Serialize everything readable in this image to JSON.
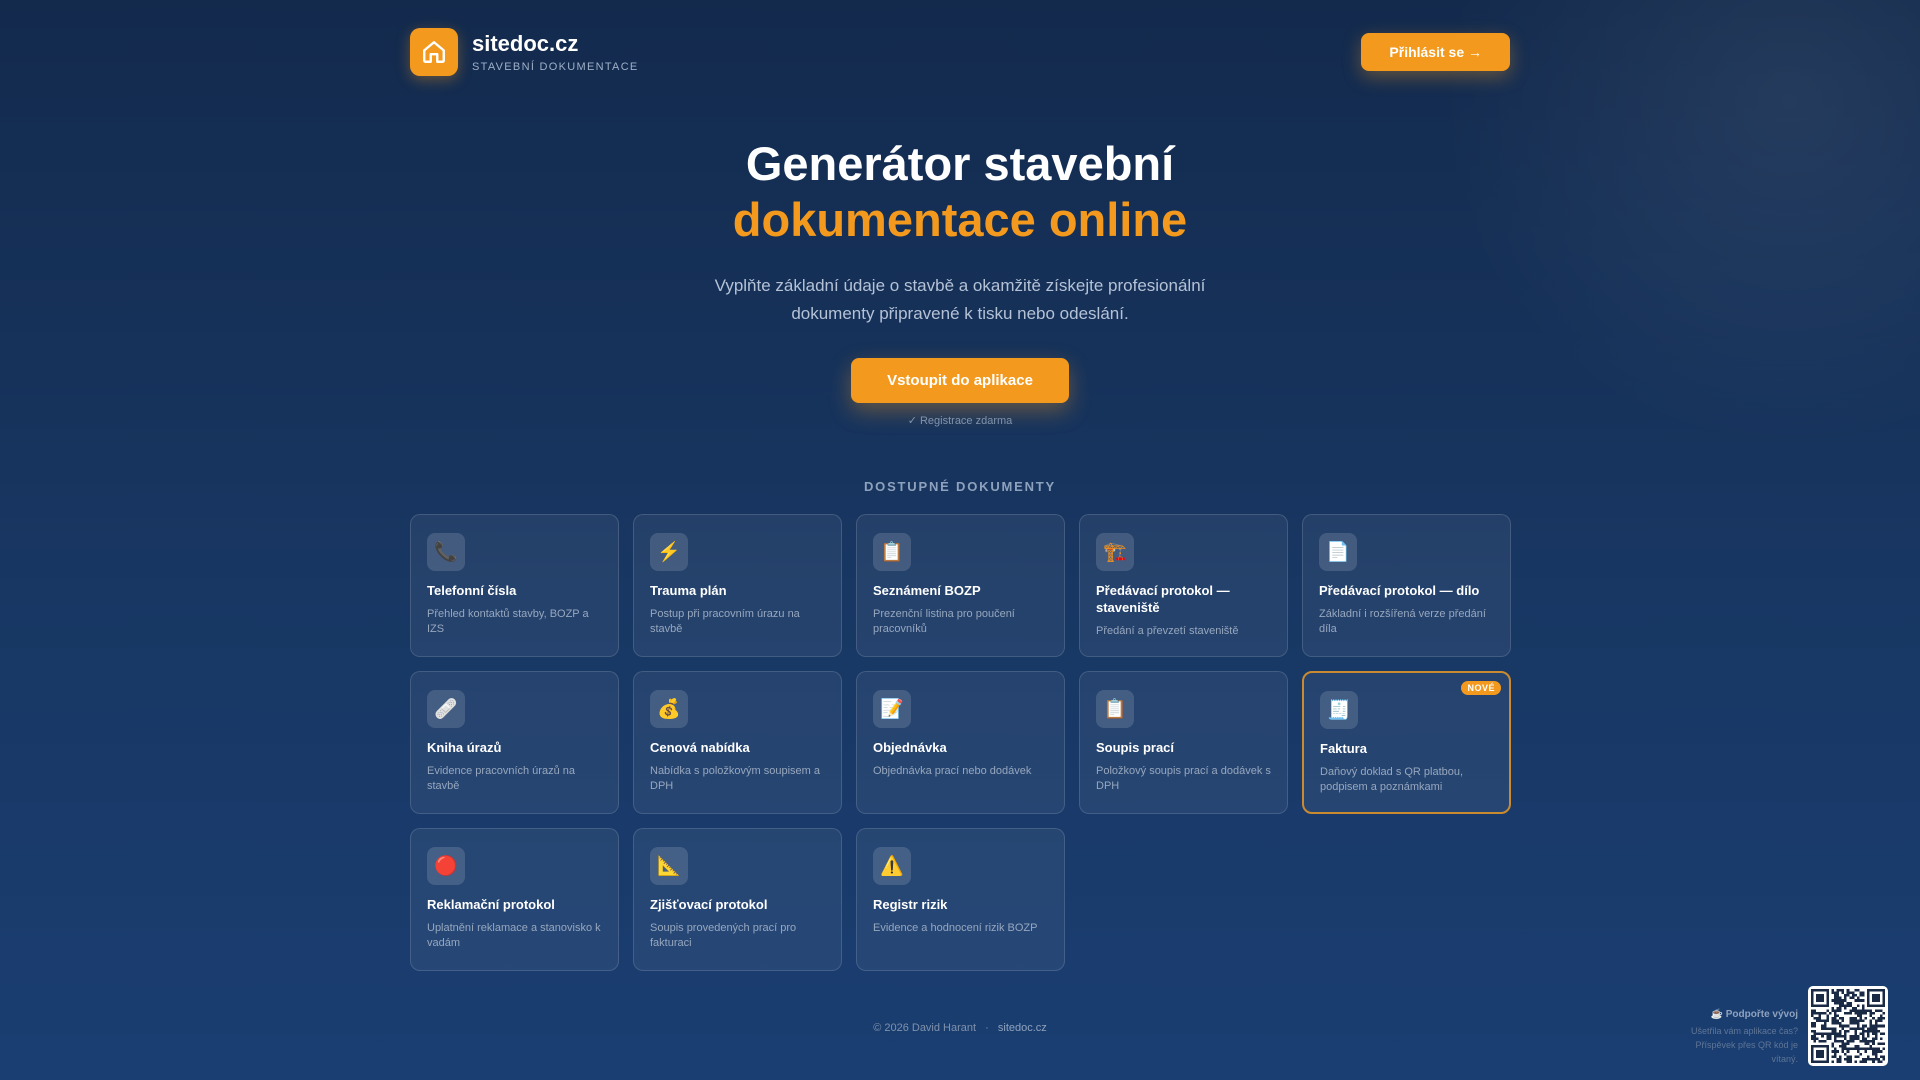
{
  "header": {
    "brand_name": "sitedoc.cz",
    "brand_subtitle": "STAVEBNÍ DOKUMENTACE",
    "login_label": "Přihlásit se →"
  },
  "hero": {
    "title_line1": "Generátor stavební",
    "title_line2": "dokumentace online",
    "description": "Vyplňte základní údaje o stavbě a okamžitě získejte profesionální dokumenty připravené k tisku nebo odeslání.",
    "cta_label": "Vstoupit do aplikace",
    "cta_note": "✓ Registrace zdarma"
  },
  "documents": {
    "section_title": "DOSTUPNÉ DOKUMENTY",
    "items": [
      {
        "icon": "📞",
        "icon_name": "phone-icon",
        "title": "Telefonní čísla",
        "desc": "Přehled kontaktů stavby, BOZP a IZS"
      },
      {
        "icon": "⚡",
        "icon_name": "lightning-icon",
        "title": "Trauma plán",
        "desc": "Postup při pracovním úrazu na stavbě"
      },
      {
        "icon": "📋",
        "icon_name": "clipboard-icon",
        "title": "Seznámení BOZP",
        "desc": "Prezenční listina pro poučení pracovníků"
      },
      {
        "icon": "🏗️",
        "icon_name": "crane-icon",
        "title": "Předávací protokol — staveniště",
        "desc": "Předání a převzetí staveniště"
      },
      {
        "icon": "📄",
        "icon_name": "document-icon",
        "title": "Předávací protokol — dílo",
        "desc": "Základní i rozšířená verze předání díla"
      },
      {
        "icon": "🩹",
        "icon_name": "bandage-icon",
        "title": "Kniha úrazů",
        "desc": "Evidence pracovních úrazů na stavbě"
      },
      {
        "icon": "💰",
        "icon_name": "money-bag-icon",
        "title": "Cenová nabídka",
        "desc": "Nabídka s položkovým soupisem a DPH"
      },
      {
        "icon": "📝",
        "icon_name": "memo-icon",
        "title": "Objednávka",
        "desc": "Objednávka prací nebo dodávek"
      },
      {
        "icon": "📋",
        "icon_name": "clipboard-icon",
        "title": "Soupis prací",
        "desc": "Položkový soupis prací a dodávek s DPH"
      },
      {
        "icon": "🧾",
        "icon_name": "receipt-icon",
        "title": "Faktura",
        "desc": "Daňový doklad s QR platbou, podpisem a poznámkami",
        "badge": "NOVÉ",
        "featured": true
      },
      {
        "icon": "🔴",
        "icon_name": "red-circle-icon",
        "title": "Reklamační protokol",
        "desc": "Uplatnění reklamace a stanovisko k vadám"
      },
      {
        "icon": "📐",
        "icon_name": "triangle-ruler-icon",
        "title": "Zjišťovací protokol",
        "desc": "Soupis provedených prací pro fakturaci"
      },
      {
        "icon": "⚠️",
        "icon_name": "warning-icon",
        "title": "Registr rizik",
        "desc": "Evidence a hodnocení rizik BOZP"
      }
    ]
  },
  "footer": {
    "copyright": "© 2026 David Harant",
    "separator": "·",
    "link": "sitedoc.cz"
  },
  "support": {
    "title": "☕ Podpořte vývoj",
    "text": "Ušetřila vám aplikace čas? Příspěvek přes QR kód je vítaný."
  },
  "colors": {
    "accent": "#f39a1e",
    "background_top": "#132a4d",
    "background_bottom": "#1a3e72"
  }
}
